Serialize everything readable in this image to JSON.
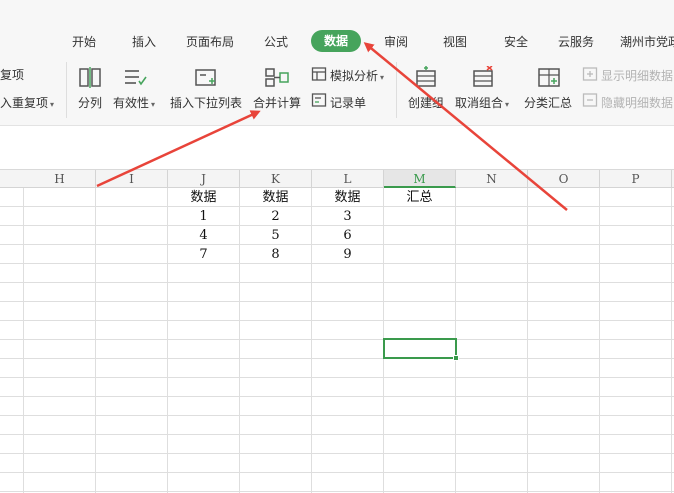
{
  "ribbon": {
    "tabs": [
      "开始",
      "插入",
      "页面布局",
      "公式",
      "数据",
      "审阅",
      "视图",
      "安全",
      "云服务",
      "潮州市党政"
    ],
    "active_tab": "数据",
    "left_partial": {
      "top": "复项",
      "bottom": "入重复项"
    },
    "tools": {
      "split": "分列",
      "validity": "有效性",
      "dropdown": "插入下拉列表",
      "consolidate": "合并计算",
      "whatif": "模拟分析",
      "record": "记录单",
      "group": "创建组",
      "ungroup": "取消组合",
      "subtotal": "分类汇总",
      "show_detail": "显示明细数据",
      "hide_detail": "隐藏明细数据"
    }
  },
  "sheet": {
    "columns": [
      "H",
      "I",
      "J",
      "K",
      "L",
      "M",
      "N",
      "O",
      "P"
    ],
    "selected_column": "M",
    "headers": [
      "数据",
      "数据",
      "数据",
      "汇总"
    ],
    "rows": [
      [
        "1",
        "2",
        "3"
      ],
      [
        "4",
        "5",
        "6"
      ],
      [
        "7",
        "8",
        "9"
      ]
    ]
  },
  "colors": {
    "accent": "#46a45c",
    "arrow": "#e8443a"
  }
}
